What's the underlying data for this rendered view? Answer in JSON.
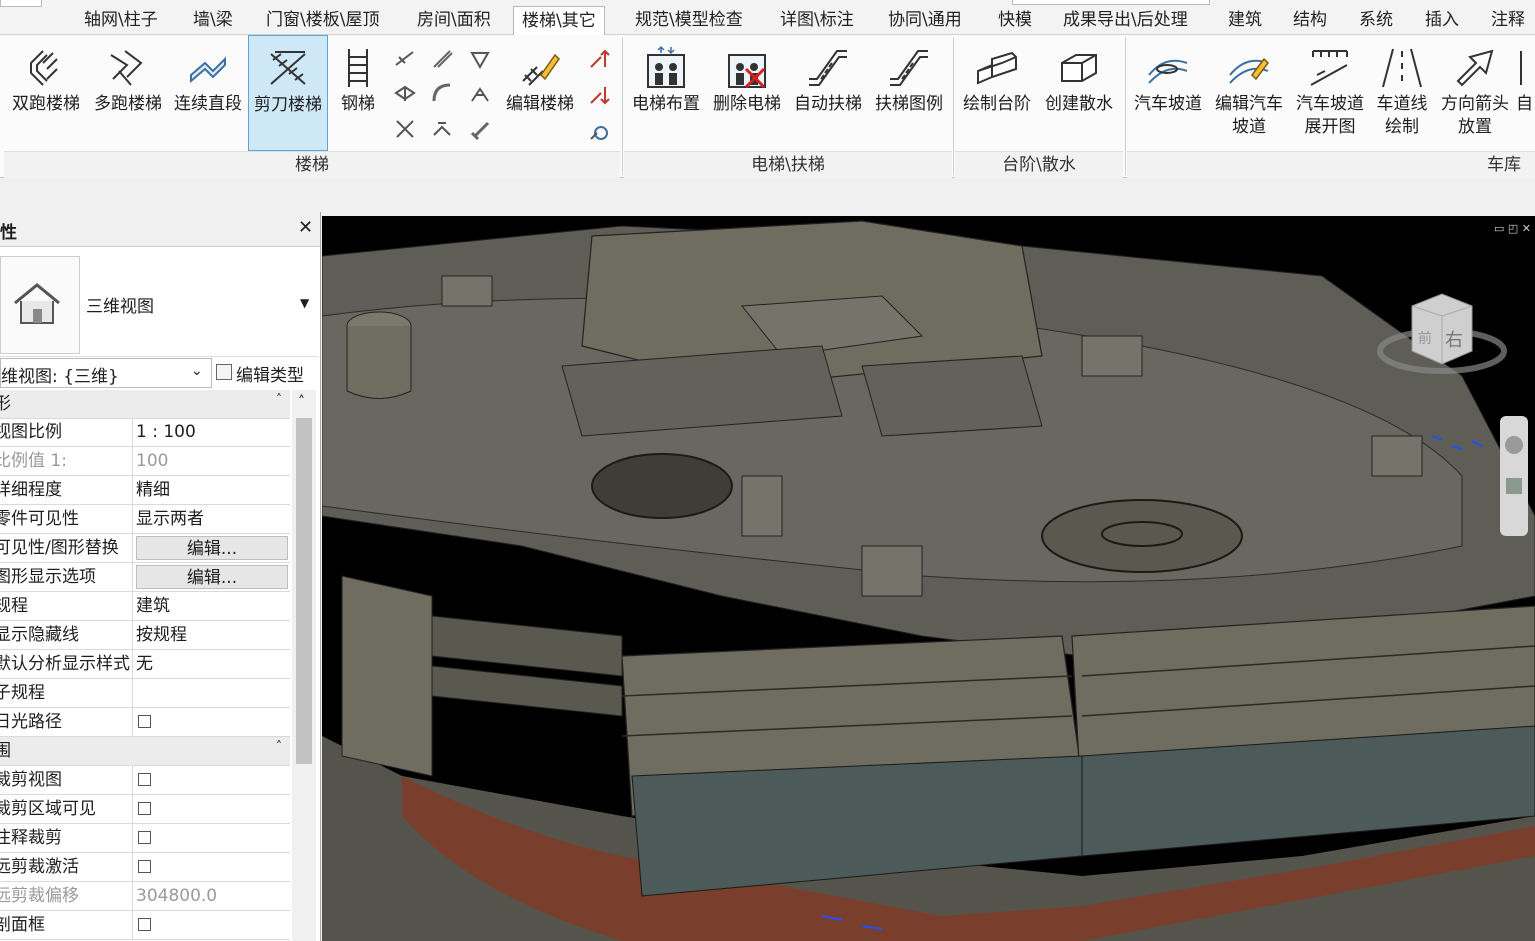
{
  "tabs": [
    "轴网\\柱子",
    "墙\\梁",
    "门窗\\楼板\\屋顶",
    "房间\\面积",
    "楼梯\\其它",
    "规范\\模型检查",
    "详图\\标注",
    "协同\\通用",
    "快模",
    "成果导出\\后处理",
    "建筑",
    "结构",
    "系统",
    "插入",
    "注释"
  ],
  "active_tab": "楼梯\\其它",
  "ribbon": {
    "stairs": {
      "double_run": "双跑楼梯",
      "multi_run": "多跑楼梯",
      "continuous": "连续直段",
      "scissor": "剪刀楼梯",
      "steel": "钢梯",
      "edit_stair": "编辑楼梯",
      "panel": "楼梯"
    },
    "elevator": {
      "layout": "电梯布置",
      "delete": "删除电梯",
      "escalator": "自动扶梯",
      "escalator_legend": "扶梯图例",
      "panel": "电梯\\扶梯"
    },
    "steps": {
      "draw_steps": "绘制台阶",
      "apron": "创建散水",
      "panel": "台阶\\散水"
    },
    "garage": {
      "ramp": "汽车坡道",
      "edit_ramp_1": "编辑汽车",
      "edit_ramp_2": "坡道",
      "ramp_unfold_1": "汽车坡道",
      "ramp_unfold_2": "展开图",
      "lane_1": "车道线",
      "lane_2": "绘制",
      "arrow_1": "方向箭头",
      "arrow_2": "放置",
      "more": "自",
      "panel": "车库"
    }
  },
  "properties": {
    "title": "性",
    "close": "✕",
    "type_name": "三维视图",
    "instance_selector": "维视图: {三维}",
    "edit_type": "编辑类型",
    "section_graphics": "形",
    "rows": [
      {
        "k": "视图比例",
        "v": "1 : 100"
      },
      {
        "k": "比例值 1:",
        "v": "100"
      },
      {
        "k": "详细程度",
        "v": "精细"
      },
      {
        "k": "零件可见性",
        "v": "显示两者"
      },
      {
        "k": "可见性/图形替换",
        "v": "编辑..."
      },
      {
        "k": "图形显示选项",
        "v": "编辑..."
      },
      {
        "k": "规程",
        "v": "建筑"
      },
      {
        "k": "显示隐藏线",
        "v": "按规程"
      },
      {
        "k": "默认分析显示样式",
        "v": "无"
      },
      {
        "k": "子规程",
        "v": ""
      },
      {
        "k": "日光路径",
        "v": ""
      }
    ],
    "section_extents": "围",
    "rows2": [
      {
        "k": "裁剪视图",
        "v": ""
      },
      {
        "k": "裁剪区域可见",
        "v": ""
      },
      {
        "k": "注释裁剪",
        "v": ""
      },
      {
        "k": "远剪裁激活",
        "v": ""
      },
      {
        "k": "远剪裁偏移",
        "v": "304800.0"
      },
      {
        "k": "剖面框",
        "v": ""
      }
    ]
  },
  "viewcube": {
    "face_right": "右",
    "face_front": "前"
  },
  "colors": {
    "accent": "#5aa6d6",
    "building": "#6e6d5f",
    "ground": "#55544c",
    "plaza": "#7a3f2c"
  }
}
